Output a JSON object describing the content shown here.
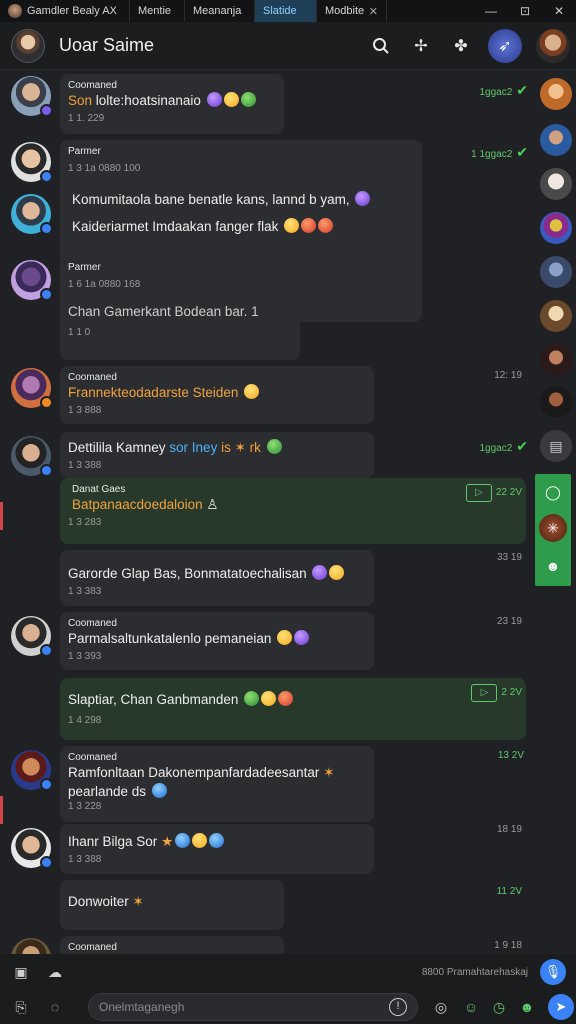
{
  "tabs": [
    {
      "label": "Gamdler Bealy AX",
      "active": false
    },
    {
      "label": "Mentie",
      "active": false
    },
    {
      "label": "Meananja",
      "active": false
    },
    {
      "label": "Slatide",
      "active": true
    },
    {
      "label": "Modbite",
      "active": false
    }
  ],
  "window_controls": {
    "minimize": "—",
    "restore": "⊡",
    "close": "✕"
  },
  "header": {
    "title": "Uoar Saime"
  },
  "messages": [
    {
      "sender": "Coomaned",
      "text_pre": "Son",
      "text": " lolte:hoatsinanaio",
      "time": "1 1. 229",
      "stamp": "1ggac2"
    },
    {
      "sender": "Parmer",
      "text": "1 3 1a 0880 100",
      "time": "",
      "stamp": "1 1ggac2"
    },
    {
      "sender": "",
      "text": "Komumitaola bane benatle kans, lannd b yam,",
      "text2": "Kaideriarmet Imdaakan fanger flak",
      "time": ""
    },
    {
      "sender": "Parmer",
      "text": "1 6 1a 0880 168",
      "time": ""
    },
    {
      "sender": "",
      "text": "Chan Gamerkant Bodean bar. 1",
      "time": "1 1 0"
    },
    {
      "sender": "Coomaned",
      "text": "Frannekteodadarste Steiden",
      "time": "1 3 888",
      "stamp": "12: 19"
    },
    {
      "sender": "",
      "text_pre": "Dettilila Kamney ",
      "text": "sor Iney",
      "text_post": " is ",
      "time": "1 3 388",
      "stamp": "1ggac2"
    },
    {
      "sender": "Danat Gaes",
      "text": "Batpanaacdoedaloion",
      "time": "1 3 283",
      "stamp": "22 2V"
    },
    {
      "sender": "",
      "text": "Garorde Glap Bas, Bonmatatoechalisan",
      "time": "1 3 383",
      "stamp": "33 19"
    },
    {
      "sender": "Coomaned",
      "text": "Parmalsaltunkatalenlo pemaneian",
      "time": "1 3 393",
      "stamp": "23 19"
    },
    {
      "sender": "",
      "text": "Slaptiar, Chan Ganbmanden",
      "time": "1 4 298",
      "stamp": "2 2V"
    },
    {
      "sender": "Coomaned",
      "text": "Ramfonltaan Dakonempanfardadeesantar",
      "text2": "pearlande ds",
      "time": "1 3 228",
      "stamp": "13 2V"
    },
    {
      "sender": "",
      "text": "Ihanr Bilga Sor",
      "time": "1 3 388",
      "stamp": "18 19"
    },
    {
      "sender": "",
      "text": "Donwoiter",
      "time": "",
      "stamp": "11 2V"
    },
    {
      "sender": "Coomaned",
      "text": "",
      "time": "",
      "stamp": "1 9 18"
    }
  ],
  "composer": {
    "placeholder": "Onelmtaganegh",
    "status_text": "8800 Pramahtarehaskaj"
  },
  "icons": {
    "search": "search-icon",
    "ai": "sparkle-icon",
    "extensions": "puzzle-icon",
    "attach": "attachment-icon",
    "emoji": "emoji-icon",
    "camera": "camera-icon",
    "send": "send-icon"
  },
  "colors": {
    "accent": "#3b82f6",
    "own_bubble": "#27392b",
    "bubble": "#2c2d30",
    "tick": "#4ccf55",
    "rail_green": "#2e9c4a"
  }
}
